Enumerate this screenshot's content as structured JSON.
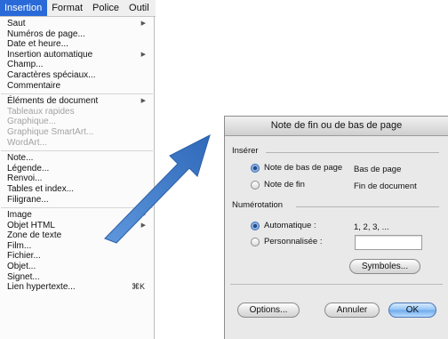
{
  "menubar": {
    "items": [
      {
        "label": "Insertion",
        "active": true
      },
      {
        "label": "Format",
        "active": false
      },
      {
        "label": "Police",
        "active": false
      },
      {
        "label": "Outil",
        "active": false
      }
    ]
  },
  "menu": {
    "groups": [
      [
        {
          "label": "Saut",
          "submenu": true
        },
        {
          "label": "Numéros de page..."
        },
        {
          "label": "Date et heure..."
        },
        {
          "label": "Insertion automatique",
          "submenu": true
        },
        {
          "label": "Champ..."
        },
        {
          "label": "Caractères spéciaux..."
        },
        {
          "label": "Commentaire"
        }
      ],
      [
        {
          "label": "Éléments de document",
          "submenu": true
        },
        {
          "label": "Tableaux rapides",
          "disabled": true
        },
        {
          "label": "Graphique...",
          "disabled": true
        },
        {
          "label": "Graphique SmartArt...",
          "disabled": true
        },
        {
          "label": "WordArt...",
          "disabled": true
        }
      ],
      [
        {
          "label": "Note..."
        },
        {
          "label": "Légende..."
        },
        {
          "label": "Renvoi..."
        },
        {
          "label": "Tables et index..."
        },
        {
          "label": "Filigrane..."
        }
      ],
      [
        {
          "label": "Image",
          "submenu": true
        },
        {
          "label": "Objet HTML",
          "submenu": true
        },
        {
          "label": "Zone de texte"
        },
        {
          "label": "Film..."
        },
        {
          "label": "Fichier..."
        },
        {
          "label": "Objet..."
        },
        {
          "label": "Signet..."
        },
        {
          "label": "Lien hypertexte...",
          "shortcut": "⌘K"
        }
      ]
    ]
  },
  "dialog": {
    "title": "Note de fin ou de bas de page",
    "inserer": {
      "label": "Insérer",
      "options": [
        {
          "label": "Note de bas de page",
          "value": "Bas de page",
          "selected": true
        },
        {
          "label": "Note de fin",
          "value": "Fin de document",
          "selected": false
        }
      ]
    },
    "numerotation": {
      "label": "Numérotation",
      "automatique": {
        "label": "Automatique :",
        "value": "1, 2, 3, ...",
        "selected": true
      },
      "personnalisee": {
        "label": "Personnalisée :",
        "value": "",
        "selected": false
      }
    },
    "symbols_button": "Symboles...",
    "options_button": "Options...",
    "cancel_button": "Annuler",
    "ok_button": "OK"
  },
  "colors": {
    "menu_highlight": "#2a6ad8",
    "arrow": "#3d78c6"
  }
}
